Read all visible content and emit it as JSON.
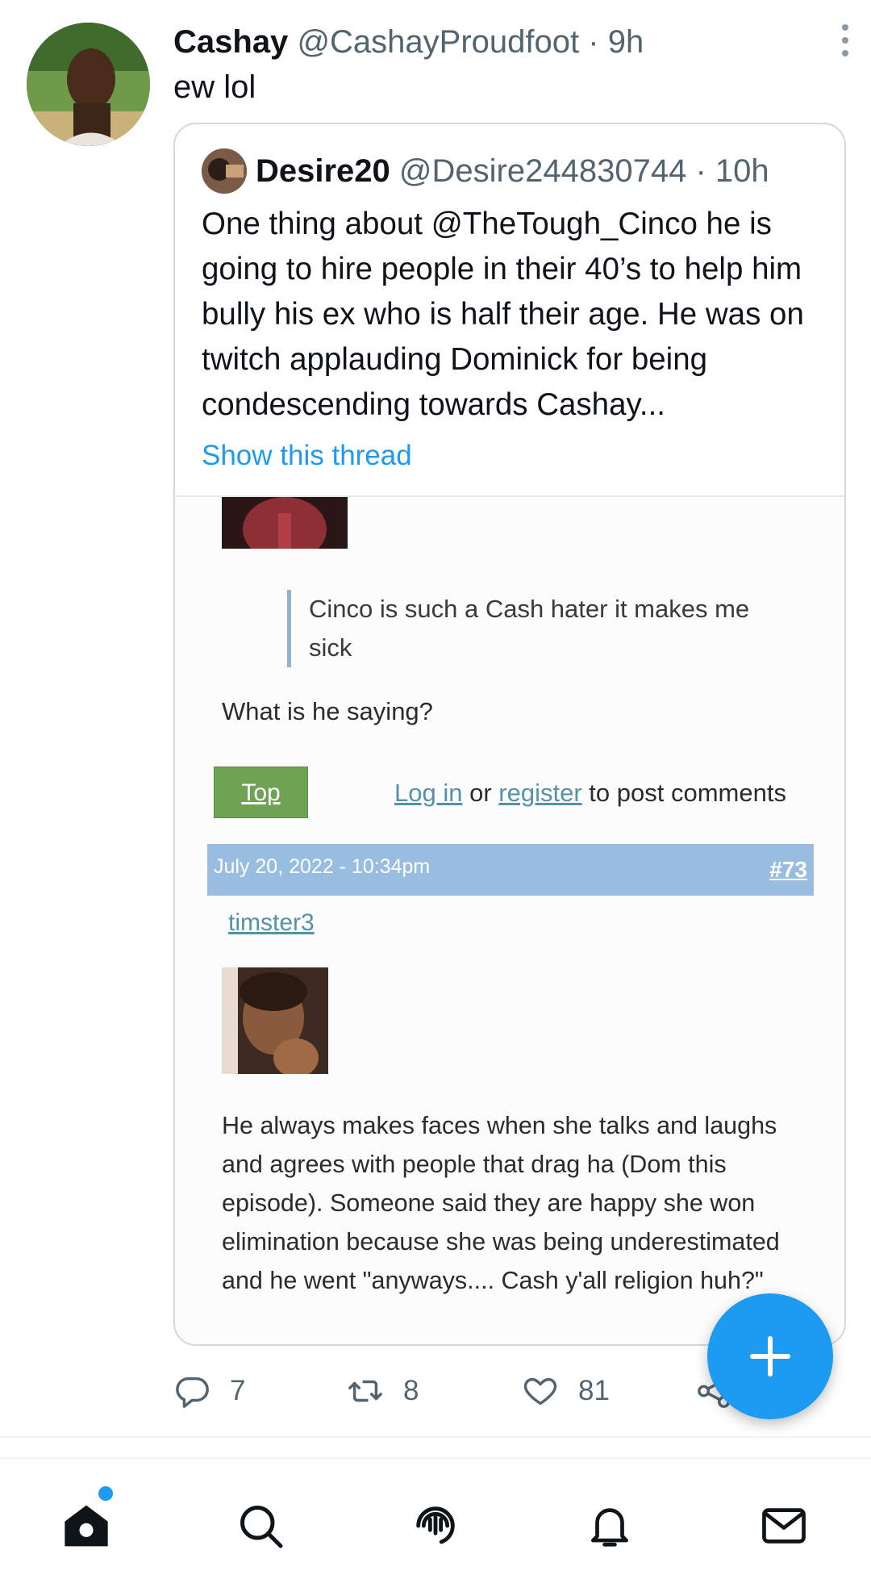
{
  "tweet": {
    "display_name": "Cashay",
    "handle": "@CashayProudfoot",
    "separator": "·",
    "time": "9h",
    "text": "ew lol"
  },
  "quote": {
    "display_name": "Desire20",
    "handle": "@Desire244830744",
    "separator": "·",
    "time": "10h",
    "text": "One thing about @TheTough_Cinco he is going to hire people in their 40’s to help him bully his ex who is half their age. He was on twitch applauding Dominick for being  condescending towards Cashay...",
    "show_thread": "Show this thread"
  },
  "forum": {
    "quote_text": "Cinco is such a Cash hater it makes me sick",
    "question": "What is he saying?",
    "top_button": "Top",
    "login_link": "Log in",
    "or_text": "or",
    "register_link": "register",
    "post_comments_text": "to post comments",
    "date": "July 20, 2022 - 10:34pm",
    "post_number": "#73",
    "username": "timster3",
    "post_body": "He always makes faces when she talks and laughs and agrees with people that drag ha (Dom this episode). Someone said they are happy she won elimination because she was being underestimated and he went \"anyways.... Cash y'all religion huh?\""
  },
  "actions": {
    "replies": "7",
    "retweets": "8",
    "likes": "81"
  },
  "icons": {
    "more": "more-vertical-icon",
    "reply": "reply-icon",
    "retweet": "retweet-icon",
    "like": "heart-icon",
    "share": "share-icon",
    "compose": "plus-icon",
    "home": "home-icon",
    "search": "search-icon",
    "spaces": "spaces-icon",
    "notifications": "bell-icon",
    "messages": "mail-icon"
  },
  "colors": {
    "accent": "#1d9bf0",
    "muted_text": "#536471",
    "forum_date_bar": "#98bde0",
    "forum_top_button": "#6da352",
    "forum_link": "#5592a8"
  }
}
